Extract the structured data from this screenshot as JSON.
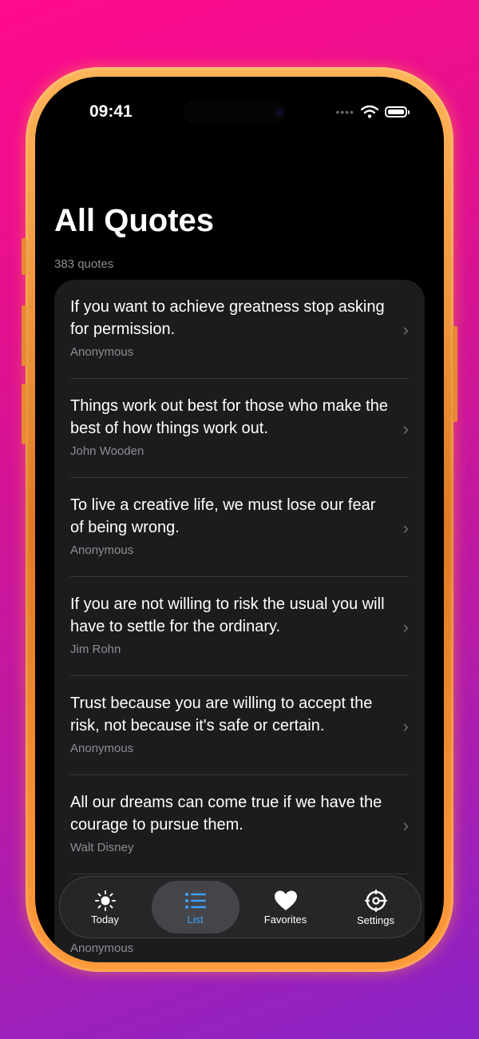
{
  "status": {
    "time": "09:41"
  },
  "header": {
    "title": "All Quotes",
    "count": "383 quotes"
  },
  "quotes": [
    {
      "text": "If you want to achieve greatness stop asking for permission.",
      "author": "Anonymous"
    },
    {
      "text": "Things work out best for those who make the best of how things work out.",
      "author": "John Wooden"
    },
    {
      "text": "To live a creative life, we must lose our fear of being wrong.",
      "author": "Anonymous"
    },
    {
      "text": "If you are not willing to risk the usual you will have to settle for the ordinary.",
      "author": "Jim Rohn"
    },
    {
      "text": "Trust because you are willing to accept the risk, not because it's safe or certain.",
      "author": "Anonymous"
    },
    {
      "text": "All our dreams can come true if we have the courage to pursue them.",
      "author": "Walt Disney"
    }
  ],
  "partial_last_author": "Anonymous",
  "tabs": [
    {
      "label": "Today",
      "icon": "sun-icon"
    },
    {
      "label": "List",
      "icon": "list-icon"
    },
    {
      "label": "Favorites",
      "icon": "heart-icon"
    },
    {
      "label": "Settings",
      "icon": "gear-icon"
    }
  ],
  "colors": {
    "accent": "#3aa0ff",
    "frame": "#f08a2c"
  }
}
